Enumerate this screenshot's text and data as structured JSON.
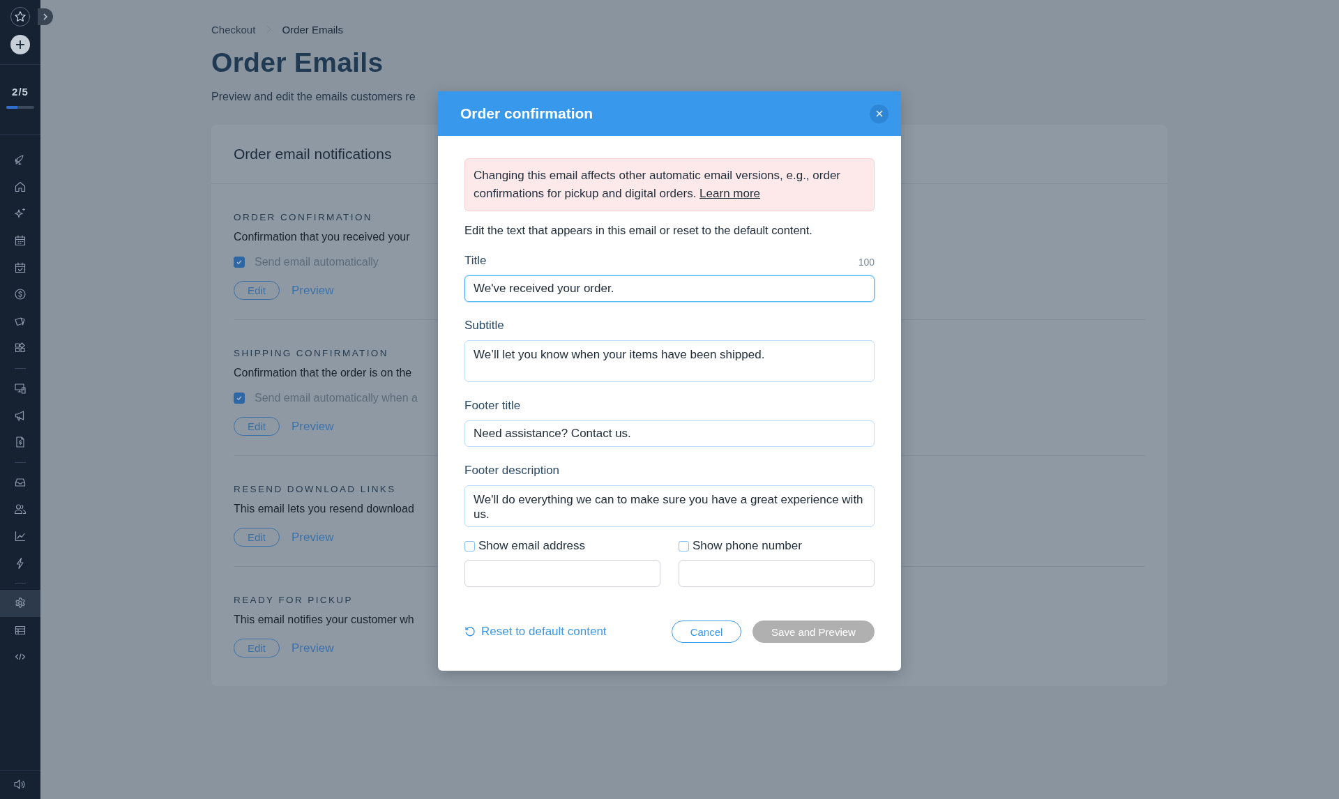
{
  "sidebar": {
    "progress": {
      "text": "2/5",
      "level": 0.4
    },
    "groups": [
      [
        {
          "selected": false
        },
        {
          "selected": false
        },
        {
          "selected": false
        },
        {
          "selected": false
        },
        {
          "selected": false
        },
        {
          "selected": false
        },
        {
          "selected": false
        },
        {
          "selected": false
        }
      ],
      [
        {
          "selected": false
        },
        {
          "selected": false
        },
        {
          "selected": false
        }
      ],
      [
        {
          "selected": false
        },
        {
          "selected": false
        },
        {
          "selected": false
        },
        {
          "selected": false
        }
      ],
      [
        {
          "selected": true
        },
        {
          "selected": false
        },
        {
          "selected": false
        }
      ]
    ]
  },
  "breadcrumb": [
    "Checkout",
    "Order Emails"
  ],
  "page": {
    "title": "Order Emails",
    "description": "Preview and edit the emails customers re"
  },
  "card": {
    "title": "Order email notifications",
    "sections": [
      {
        "heading": "ORDER CONFIRMATION",
        "description": "Confirmation that you received your",
        "checkbox": {
          "label": "Send email automatically",
          "checked": true
        },
        "edit": "Edit",
        "preview": "Preview"
      },
      {
        "heading": "SHIPPING CONFIRMATION",
        "description": "Confirmation that the order is on the",
        "checkbox": {
          "label": "Send email automatically when a",
          "checked": true
        },
        "edit": "Edit",
        "preview": "Preview"
      },
      {
        "heading": "RESEND DOWNLOAD LINKS",
        "description": "This email lets you resend download",
        "edit": "Edit",
        "preview": "Preview"
      },
      {
        "heading": "READY FOR PICKUP",
        "description": "This email notifies your customer wh",
        "edit": "Edit",
        "preview": "Preview"
      }
    ]
  },
  "modal": {
    "title": "Order confirmation",
    "alert": {
      "text": "Changing this email affects other automatic email versions, e.g., order confirmations for pickup and digital orders.",
      "link": "Learn more"
    },
    "intro": "Edit the text that appears in this email or reset to the default content.",
    "fields": [
      {
        "kind": "input",
        "label": "Title",
        "counter": "100",
        "value": "We've received your order.",
        "focused": true
      },
      {
        "kind": "textarea",
        "label": "Subtitle",
        "value": "We’ll let you know when your items have been shipped.",
        "focused": false
      },
      {
        "kind": "input",
        "label": "Footer title",
        "value": "Need assistance? Contact us.",
        "focused": false
      },
      {
        "kind": "textarea",
        "label": "Footer description",
        "value": "We'll do everything we can to make sure you have a great experience with us.",
        "focused": false
      }
    ],
    "contact_options": [
      {
        "label": "Show email address",
        "checked": false
      },
      {
        "label": "Show phone number",
        "checked": false
      }
    ],
    "reset_link": "Reset to default content",
    "buttons": [
      {
        "label": "Cancel",
        "kind": "secondary",
        "disabled": false
      },
      {
        "label": "Save and Preview",
        "kind": "primary",
        "disabled": true
      }
    ]
  }
}
